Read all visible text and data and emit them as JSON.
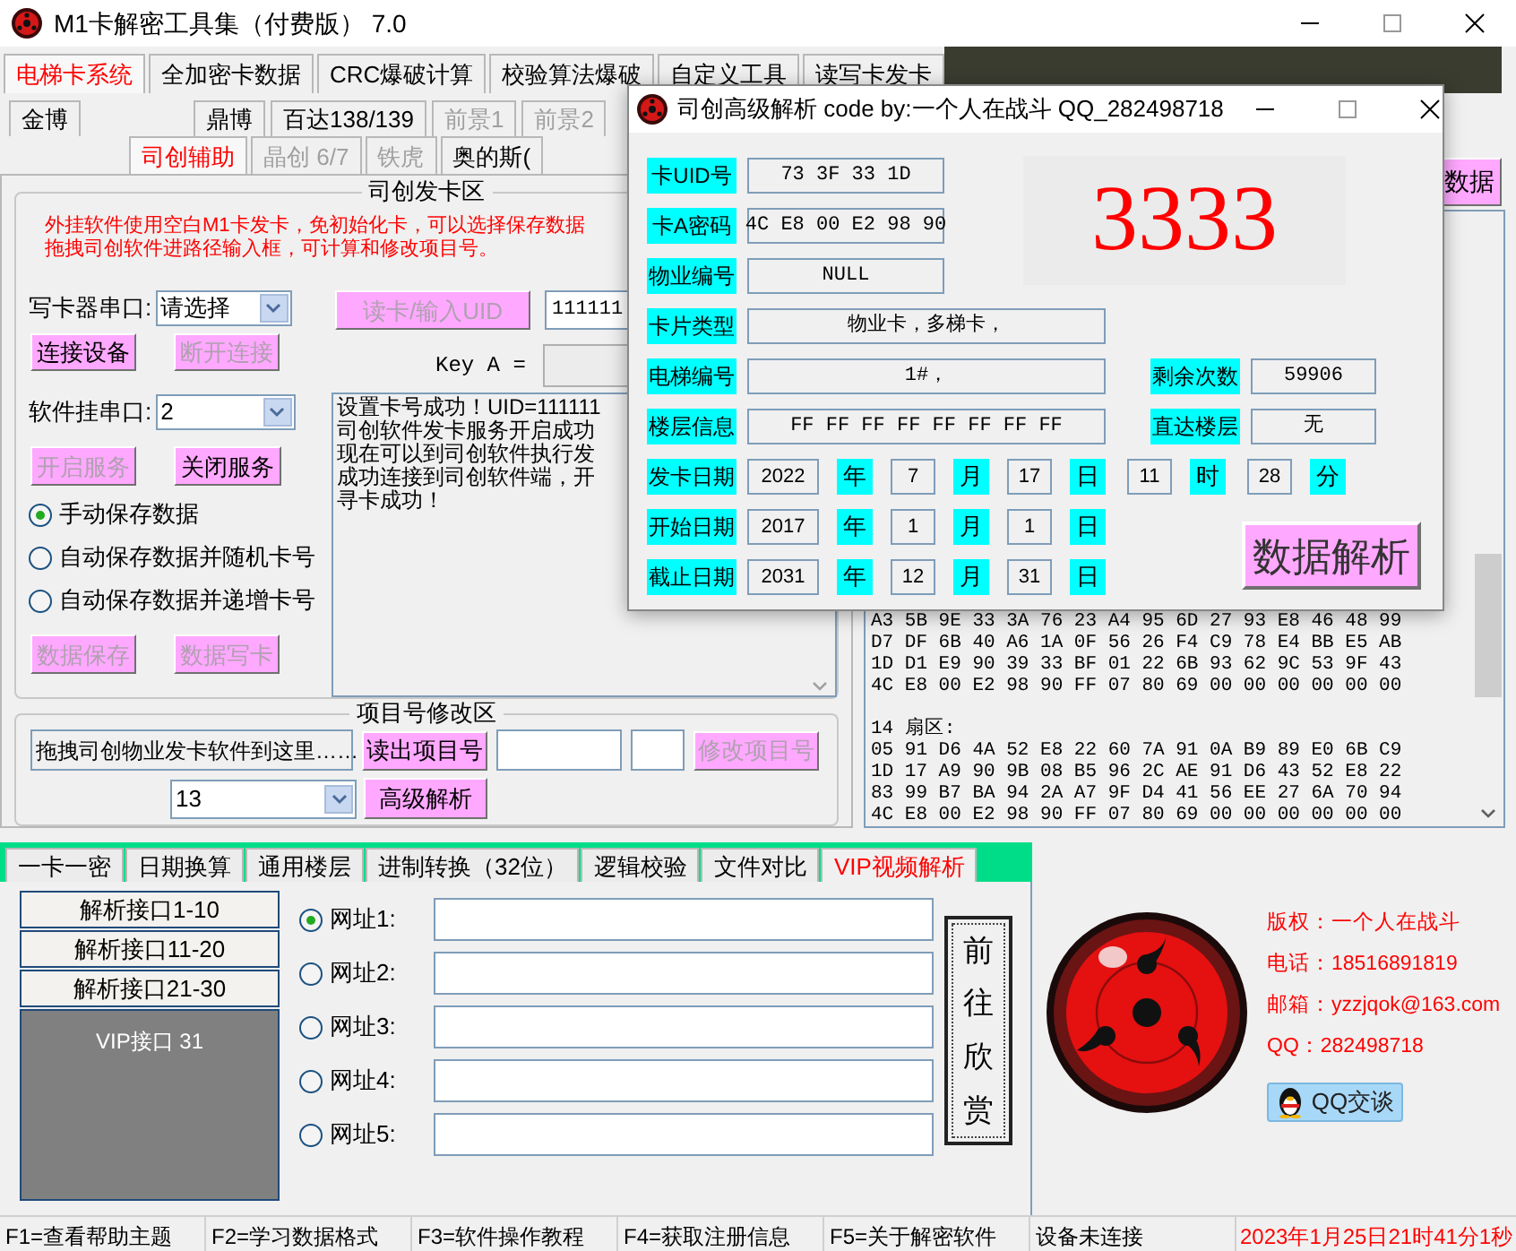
{
  "window": {
    "title": "M1卡解密工具集（付费版） 7.0"
  },
  "main_tabs": [
    {
      "label": "电梯卡系统",
      "selected": true
    },
    {
      "label": "全加密卡数据",
      "selected": false
    },
    {
      "label": "CRC爆破计算",
      "selected": false
    },
    {
      "label": "校验算法爆破",
      "selected": false
    },
    {
      "label": "自定义工具",
      "selected": false
    },
    {
      "label": "读写卡发卡",
      "selected": false
    }
  ],
  "brand_tabs_upper": [
    {
      "label": "金博",
      "selected": false,
      "disabled": false
    },
    {
      "label": "鼎博",
      "selected": false,
      "disabled": false
    },
    {
      "label": "百达138/139",
      "selected": false,
      "disabled": false
    },
    {
      "label": "前景1",
      "selected": false,
      "disabled": true
    },
    {
      "label": "前景2",
      "selected": false,
      "disabled": true
    }
  ],
  "brand_tabs_lower": [
    {
      "label": "司创辅助",
      "selected": true,
      "disabled": false
    },
    {
      "label": "晶创 6/7",
      "selected": false,
      "disabled": true
    },
    {
      "label": "铁虎",
      "selected": false,
      "disabled": true
    },
    {
      "label": "奥的斯(",
      "selected": false,
      "disabled": false
    }
  ],
  "issue_panel": {
    "title": "司创发卡区",
    "notice": [
      "外挂软件使用空白M1卡发卡，免初始化卡，可以选择保存数据",
      "拖拽司创软件进路径输入框，可计算和修改项目号。"
    ],
    "writer_port": {
      "label": "写卡器串口:",
      "value": "请选择"
    },
    "read_button": {
      "label": "读卡/输入UID",
      "disabled": true
    },
    "uid_value": "111111",
    "connect_button": {
      "label": "连接设备",
      "disabled": false
    },
    "disconnect_button": {
      "label": "断开连接",
      "disabled": true
    },
    "key_a_label": "Key A =",
    "software_port": {
      "label": "软件挂串口:",
      "value": "2"
    },
    "log_lines": [
      "设置卡号成功！UID=111111",
      "司创软件发卡服务开启成功",
      "现在可以到司创软件执行发",
      "成功连接到司创软件端，开",
      "寻卡成功！"
    ],
    "start_button": {
      "label": "开启服务",
      "disabled": true
    },
    "stop_button": {
      "label": "关闭服务",
      "disabled": false
    },
    "save_modes": [
      {
        "label": "手动保存数据",
        "selected": true
      },
      {
        "label": "自动保存数据并随机卡号",
        "selected": false
      },
      {
        "label": "自动保存数据并递增卡号",
        "selected": false
      }
    ],
    "save_button": {
      "label": "数据保存",
      "disabled": true
    },
    "write_button": {
      "label": "数据写卡",
      "disabled": true
    }
  },
  "project_panel": {
    "title": "项目号修改区",
    "path_field": "拖拽司创物业发卡软件到这里……",
    "read_button": {
      "label": "读出项目号",
      "disabled": false
    },
    "modify_button": {
      "label": "修改项目号",
      "disabled": true
    },
    "dropdown": "13",
    "analyze_button": {
      "label": "高级解析",
      "disabled": false
    }
  },
  "right_panel": {
    "data_button": "数据",
    "hex_lines": [
      "A3 5B 9E 33 3A 76 23 A4 95 6D 27 93 E8 46 48 99",
      "D7 DF 6B 40 A6 1A 0F 56 26 F4 C9 78 E4 BB E5 AB",
      "1D D1 E9 90 39 33 BF 01 22 6B 93 62 9C 53 9F 43",
      "4C E8 00 E2 98 90 FF 07 80 69 00 00 00 00 00 00",
      "14 扇区:",
      "05 91 D6 4A 52 E8 22 60 7A 91 0A B9 89 E0 6B C9",
      "1D 17 A9 90 9B 08 B5 96 2C AE 91 D6 43 52 E8 22",
      "83 99 B7 BA 94 2A A7 9F D4 41 56 EE 27 6A 70 94",
      "4C E8 00 E2 98 90 FF 07 80 69 00 00 00 00 00 00"
    ]
  },
  "bottom_tabs": [
    {
      "label": "一卡一密",
      "selected": false
    },
    {
      "label": "日期换算",
      "selected": false
    },
    {
      "label": "通用楼层",
      "selected": false
    },
    {
      "label": "进制转换（32位）",
      "selected": false
    },
    {
      "label": "逻辑校验",
      "selected": false
    },
    {
      "label": "文件对比",
      "selected": false
    },
    {
      "label": "VIP视频解析",
      "selected": true
    }
  ],
  "vip_panel": {
    "interface_buttons": [
      "解析接口1-10",
      "解析接口11-20",
      "解析接口21-30"
    ],
    "vip_label": "VIP接口 31",
    "urls": [
      {
        "label": "网址1:",
        "selected": true
      },
      {
        "label": "网址2:",
        "selected": false
      },
      {
        "label": "网址3:",
        "selected": false
      },
      {
        "label": "网址4:",
        "selected": false
      },
      {
        "label": "网址5:",
        "selected": false
      }
    ],
    "go_button": "前往欣赏"
  },
  "contact": {
    "lines": [
      "版权：一个人在战斗",
      "电话：18516891819",
      "邮箱：yzzjqok@163.com",
      "QQ：282498718"
    ],
    "qq_button": "QQ交谈"
  },
  "status_bar": {
    "items": [
      "F1=查看帮助主题",
      "F2=学习数据格式",
      "F3=软件操作教程",
      "F4=获取注册信息",
      "F5=关于解密软件",
      "设备未连接"
    ],
    "clock": "2023年1月25日21时41分1秒"
  },
  "dialog": {
    "title": "司创高级解析 code by:一个人在战斗 QQ_282498718",
    "card_uid": {
      "label": "卡UID号",
      "value": "73 3F 33 1D"
    },
    "card_key_a": {
      "label": "卡A密码",
      "value": "4C E8 00 E2 98 90"
    },
    "property_no": {
      "label": "物业编号",
      "value": "NULL"
    },
    "big_number": "3333",
    "card_type": {
      "label": "卡片类型",
      "value": "物业卡，多梯卡，"
    },
    "elevator_no": {
      "label": "电梯编号",
      "value": "1#，"
    },
    "remaining": {
      "label": "剩余次数",
      "value": "59906"
    },
    "floor_info": {
      "label": "楼层信息",
      "value": "FF FF FF FF FF FF FF FF"
    },
    "direct_floor": {
      "label": "直达楼层",
      "value": "无"
    },
    "dates": [
      {
        "label": "发卡日期",
        "parts": [
          {
            "value": "2022",
            "unit": "年"
          },
          {
            "value": "7",
            "unit": "月"
          },
          {
            "value": "17",
            "unit": "日"
          },
          {
            "value": "11",
            "unit": "时"
          },
          {
            "value": "28",
            "unit": "分"
          }
        ]
      },
      {
        "label": "开始日期",
        "parts": [
          {
            "value": "2017",
            "unit": "年"
          },
          {
            "value": "1",
            "unit": "月"
          },
          {
            "value": "1",
            "unit": "日"
          }
        ]
      },
      {
        "label": "截止日期",
        "parts": [
          {
            "value": "2031",
            "unit": "年"
          },
          {
            "value": "12",
            "unit": "月"
          },
          {
            "value": "31",
            "unit": "日"
          }
        ]
      }
    ],
    "analyze_button": "数据解析"
  }
}
